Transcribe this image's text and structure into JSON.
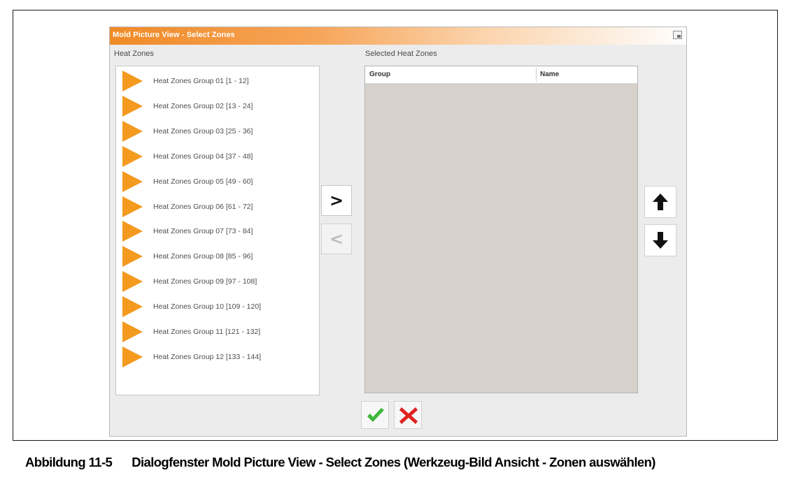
{
  "dialog": {
    "title": "Mold Picture View - Select Zones",
    "heat_zones_label": "Heat Zones",
    "selected_label": "Selected Heat Zones",
    "columns": [
      "Group",
      "Name"
    ],
    "heat_zones": [
      "Heat Zones Group 01 [1 - 12]",
      "Heat Zones Group 02 [13 - 24]",
      "Heat Zones Group 03 [25 - 36]",
      "Heat Zones Group 04 [37 - 48]",
      "Heat Zones Group 05 [49 - 60]",
      "Heat Zones Group 06 [61 - 72]",
      "Heat Zones Group 07 [73 - 84]",
      "Heat Zones Group 08 [85 - 96]",
      "Heat Zones Group 09 [97 - 108]",
      "Heat Zones Group 10 [109 - 120]",
      "Heat Zones Group 11 [121 - 132]",
      "Heat Zones Group 12 [133 - 144]"
    ],
    "add_label": ">",
    "remove_label": "<",
    "icons": {
      "list_item": "triangle-right-icon",
      "move_up": "arrow-up-icon",
      "move_down": "arrow-down-icon",
      "ok": "checkmark-icon",
      "cancel": "cross-icon",
      "window": "restore-icon"
    },
    "colors": {
      "title_accent": "#f08a26",
      "list_triangle": "#f39a1f",
      "ok_green": "#3db63a",
      "cancel_red": "#e02020",
      "selected_panel_bg": "#d6d2cb"
    }
  },
  "caption": {
    "figure": "Abbildung 11-5",
    "text": "Dialogfenster Mold Picture View - Select Zones (Werkzeug-Bild Ansicht - Zonen auswählen)"
  }
}
